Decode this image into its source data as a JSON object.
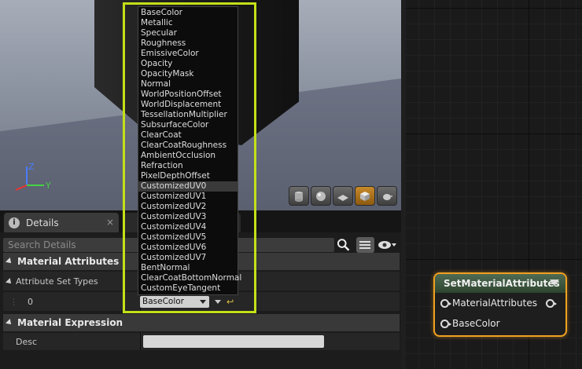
{
  "details": {
    "tab_label": "Details",
    "tab_close": "×",
    "search_placeholder": "Search Details",
    "categories": {
      "material_attributes": "Material Attributes",
      "material_expression": "Material Expression"
    },
    "rows": {
      "attribute_set_types": "Attribute Set Types",
      "index_value": "0",
      "desc_label": "Desc"
    }
  },
  "dropdown": {
    "items": [
      "BaseColor",
      "Metallic",
      "Specular",
      "Roughness",
      "EmissiveColor",
      "Opacity",
      "OpacityMask",
      "Normal",
      "WorldPositionOffset",
      "WorldDisplacement",
      "TessellationMultiplier",
      "SubsurfaceColor",
      "ClearCoat",
      "ClearCoatRoughness",
      "AmbientOcclusion",
      "Refraction",
      "PixelDepthOffset",
      "CustomizedUV0",
      "CustomizedUV1",
      "CustomizedUV2",
      "CustomizedUV3",
      "CustomizedUV4",
      "CustomizedUV5",
      "CustomizedUV6",
      "CustomizedUV7",
      "BentNormal",
      "ClearCoatBottomNormal",
      "CustomEyeTangent"
    ],
    "highlighted": "CustomizedUV0",
    "selected_value": "BaseColor"
  },
  "node": {
    "title": "SetMaterialAttributes",
    "pins": [
      "MaterialAttributes",
      "BaseColor"
    ]
  },
  "axis": {
    "x": "Y",
    "z": "Z"
  },
  "colors": {
    "highlight": "#c4e018",
    "node_border": "#f0a020",
    "node_header": "#3f5a42"
  }
}
